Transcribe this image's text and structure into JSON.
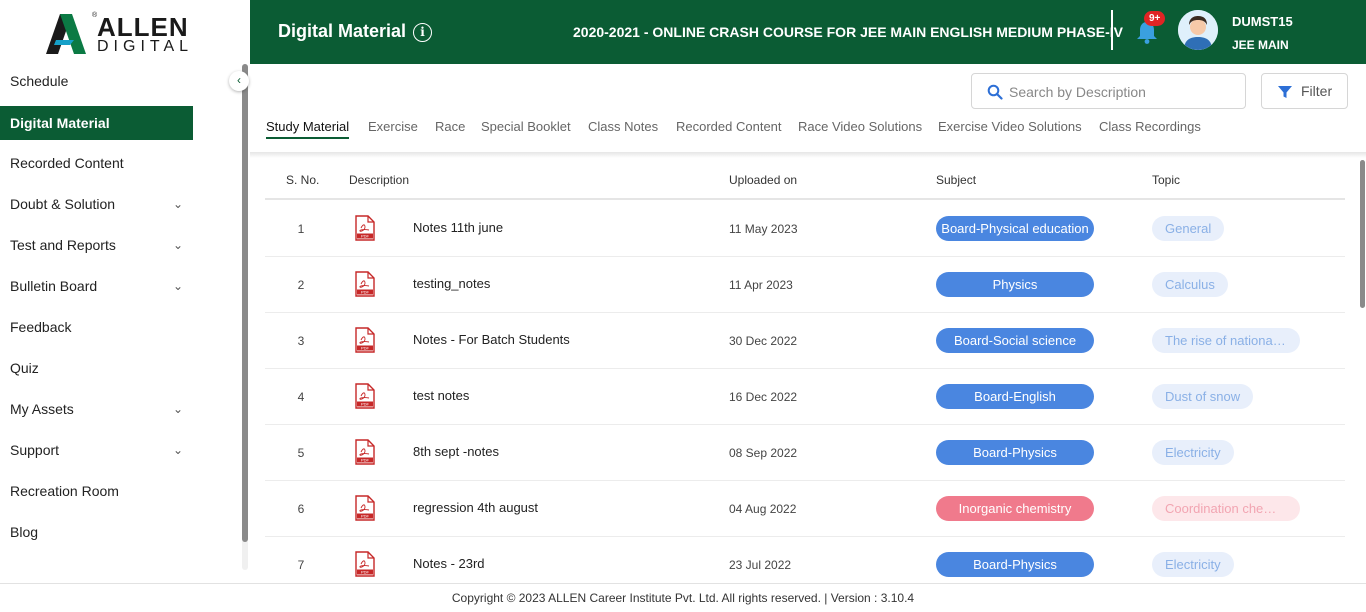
{
  "brand": {
    "logo_text": "ALLEN",
    "logo_sub": "DIGITAL",
    "logo_reg": "®"
  },
  "header": {
    "page_title": "Digital Material",
    "info_symbol": "i",
    "course_title": "2020-2021 - ONLINE CRASH COURSE FOR JEE MAIN ENGLISH MEDIUM PHASE-IV",
    "notifications_badge": "9+",
    "user_name": "DUMST15",
    "user_course": "JEE MAIN"
  },
  "sidebar": {
    "items": [
      {
        "label": "Schedule",
        "active": false,
        "expandable": false
      },
      {
        "label": "Digital Material",
        "active": true,
        "expandable": false
      },
      {
        "label": "Recorded Content",
        "active": false,
        "expandable": false
      },
      {
        "label": "Doubt & Solution",
        "active": false,
        "expandable": true
      },
      {
        "label": "Test and Reports",
        "active": false,
        "expandable": true
      },
      {
        "label": "Bulletin Board",
        "active": false,
        "expandable": true
      },
      {
        "label": "Feedback",
        "active": false,
        "expandable": false
      },
      {
        "label": "Quiz",
        "active": false,
        "expandable": false
      },
      {
        "label": "My Assets",
        "active": false,
        "expandable": true
      },
      {
        "label": "Support",
        "active": false,
        "expandable": true
      },
      {
        "label": "Recreation Room",
        "active": false,
        "expandable": false
      },
      {
        "label": "Blog",
        "active": false,
        "expandable": false
      }
    ]
  },
  "search": {
    "placeholder": "Search by Description"
  },
  "filter": {
    "label": "Filter"
  },
  "tabs": [
    {
      "label": "Study Material",
      "active": true
    },
    {
      "label": "Exercise",
      "active": false
    },
    {
      "label": "Race",
      "active": false
    },
    {
      "label": "Special Booklet",
      "active": false
    },
    {
      "label": "Class Notes",
      "active": false
    },
    {
      "label": "Recorded Content",
      "active": false
    },
    {
      "label": "Race Video Solutions",
      "active": false
    },
    {
      "label": "Exercise Video Solutions",
      "active": false
    },
    {
      "label": "Class Recordings",
      "active": false
    }
  ],
  "table": {
    "columns": [
      "S. No.",
      "Description",
      "Uploaded on",
      "Subject",
      "Topic"
    ],
    "file_icon_label": "PDF",
    "rows": [
      {
        "sno": "1",
        "description": "Notes 11th june",
        "uploaded": "11 May 2023",
        "subject": "Board-Physical education",
        "topic": "General",
        "color": "blue"
      },
      {
        "sno": "2",
        "description": "testing_notes",
        "uploaded": "11 Apr 2023",
        "subject": "Physics",
        "topic": "Calculus",
        "color": "blue"
      },
      {
        "sno": "3",
        "description": "Notes - For Batch Students",
        "uploaded": "30 Dec 2022",
        "subject": "Board-Social science",
        "topic": "The rise of nationali...",
        "color": "blue"
      },
      {
        "sno": "4",
        "description": "test notes",
        "uploaded": "16 Dec 2022",
        "subject": "Board-English",
        "topic": "Dust of snow",
        "color": "blue"
      },
      {
        "sno": "5",
        "description": "8th sept -notes",
        "uploaded": "08 Sep 2022",
        "subject": "Board-Physics",
        "topic": "Electricity",
        "color": "blue"
      },
      {
        "sno": "6",
        "description": "regression 4th august",
        "uploaded": "04 Aug 2022",
        "subject": "Inorganic chemistry",
        "topic": "Coordination chemi...",
        "color": "pink"
      },
      {
        "sno": "7",
        "description": "Notes - 23rd",
        "uploaded": "23 Jul 2022",
        "subject": "Board-Physics",
        "topic": "Electricity",
        "color": "blue"
      }
    ]
  },
  "colors": {
    "brand_green": "#0b5c34",
    "subject_blue": "#4a86e0",
    "topic_blue_bg": "#e8effb",
    "topic_blue_fg": "#8ab0e6",
    "subject_pink": "#f07a8c",
    "topic_pink_bg": "#fde7ea",
    "topic_pink_fg": "#f2a5b2",
    "pdf_red": "#c62828"
  },
  "footer": {
    "text": "Copyright © 2023 ALLEN Career Institute Pvt. Ltd. All rights reserved. | Version : 3.10.4"
  }
}
